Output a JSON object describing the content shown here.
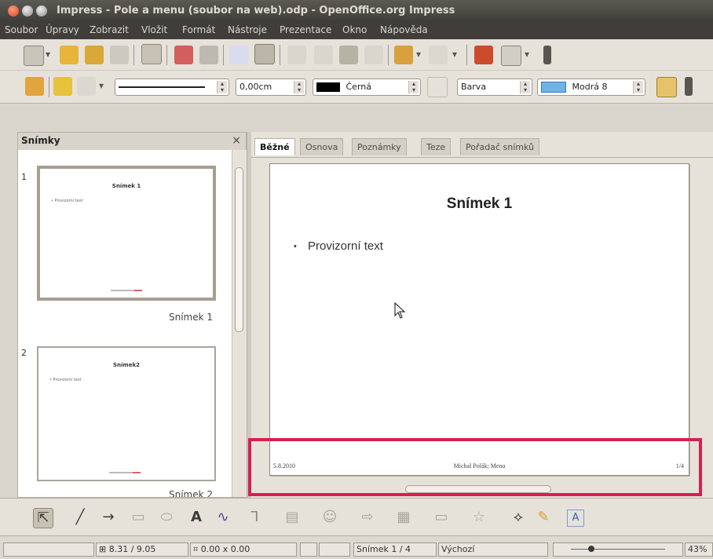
{
  "window": {
    "title": "Impress - Pole a menu (soubor na web).odp - OpenOffice.org Impress"
  },
  "menu": [
    "Soubor",
    "Úpravy",
    "Zobrazit",
    "Vložit",
    "Formát",
    "Nástroje",
    "Prezentace",
    "Okno",
    "Nápověda"
  ],
  "toolbar2": {
    "line_width": "0,00cm",
    "line_color": "Černá",
    "area_style": "Barva",
    "area_color": "Modrá 8"
  },
  "slides_panel": {
    "title": "Snímky",
    "close": "×",
    "thumbnails": [
      {
        "number": "1",
        "label": "Snímek 1",
        "title": "Snímek 1",
        "bullet": "• Provizorní text",
        "selected": true
      },
      {
        "number": "2",
        "label": "Snímek 2",
        "title": "Snímek2",
        "bullet": "• Provizorní text",
        "selected": false
      }
    ]
  },
  "tabs": [
    "Běžné",
    "Osnova",
    "Poznámky",
    "Teze",
    "Pořadač snímků"
  ],
  "slide": {
    "title": "Snímek 1",
    "bullet_dot": "•",
    "bullet": "Provizorní text",
    "footer_date": "5.8.2010",
    "footer_text": "Michal Polák; Menu",
    "footer_number": "1/4"
  },
  "statusbar": {
    "position": "8.31 / 9.05",
    "size": "0.00 x 0.00",
    "slide": "Snímek 1 / 4",
    "layout": "Výchozí",
    "zoom": "43%"
  }
}
